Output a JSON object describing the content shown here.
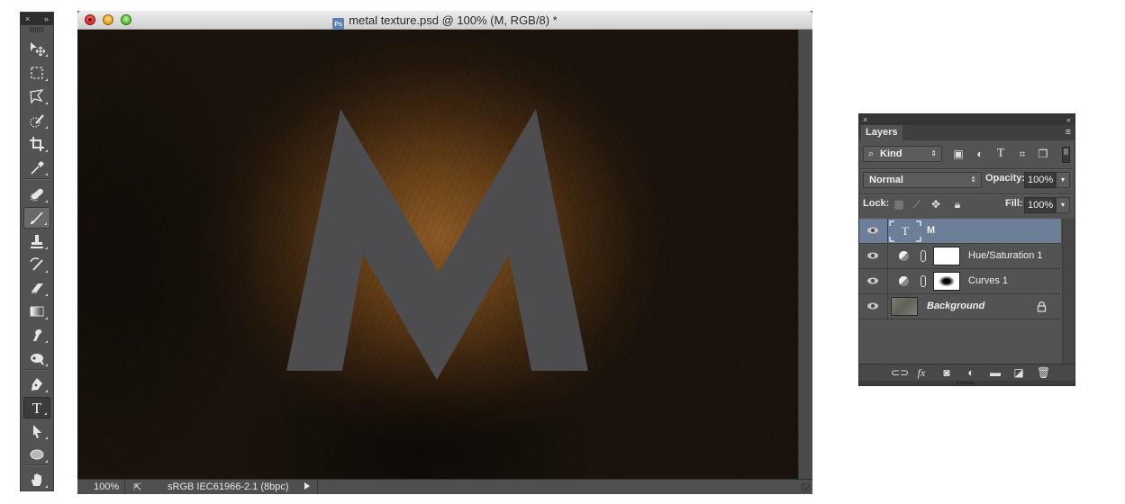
{
  "tools_panel": {
    "header_close": "×",
    "header_expand": "»",
    "tools": [
      {
        "id": "move",
        "label": "Move Tool",
        "icon": "move-icon"
      },
      {
        "id": "marquee",
        "label": "Rectangular Marquee Tool",
        "icon": "marquee-icon"
      },
      {
        "id": "lasso",
        "label": "Polygonal Lasso Tool",
        "icon": "lasso-icon"
      },
      {
        "id": "quick-select",
        "label": "Quick Selection Tool",
        "icon": "quick-select-icon"
      },
      {
        "id": "crop",
        "label": "Crop Tool",
        "icon": "crop-icon"
      },
      {
        "id": "eyedropper",
        "label": "Eyedropper Tool",
        "icon": "eyedropper-icon"
      },
      {
        "id": "healing",
        "label": "Spot Healing Brush Tool",
        "icon": "bandage-icon"
      },
      {
        "id": "brush",
        "label": "Brush Tool",
        "icon": "brush-icon"
      },
      {
        "id": "stamp",
        "label": "Clone Stamp Tool",
        "icon": "stamp-icon"
      },
      {
        "id": "history-brush",
        "label": "History Brush Tool",
        "icon": "history-brush-icon"
      },
      {
        "id": "eraser",
        "label": "Eraser Tool",
        "icon": "eraser-icon"
      },
      {
        "id": "gradient",
        "label": "Gradient Tool",
        "icon": "gradient-icon"
      },
      {
        "id": "smudge",
        "label": "Smudge Tool",
        "icon": "smudge-icon"
      },
      {
        "id": "dodge",
        "label": "Dodge Tool",
        "icon": "dodge-icon"
      },
      {
        "id": "pen",
        "label": "Pen Tool",
        "icon": "pen-icon"
      },
      {
        "id": "type",
        "label": "Horizontal Type Tool",
        "icon": "type-icon",
        "glyph": "T"
      },
      {
        "id": "path-select",
        "label": "Path Selection Tool",
        "icon": "arrow-icon"
      },
      {
        "id": "ellipse",
        "label": "Ellipse Tool",
        "icon": "ellipse-icon"
      },
      {
        "id": "hand",
        "label": "Hand Tool",
        "icon": "hand-icon"
      }
    ],
    "active_tool": "type"
  },
  "document": {
    "title": "metal texture.psd @ 100% (M, RGB/8) *",
    "file_icon_label": "Ps",
    "canvas_text": "M",
    "colors": {
      "letter": "#4d4d50",
      "glow": "#8a5a26",
      "background": "#1a130c"
    },
    "status": {
      "zoom": "100%",
      "profile": "sRGB IEC61966-2.1 (8bpc)"
    }
  },
  "layers_panel": {
    "header_close": "×",
    "header_collapse": "«",
    "tab": "Layers",
    "menu_icon": "≡",
    "filter": {
      "label": "Kind",
      "icons": [
        "image-filter-icon",
        "adjustment-filter-icon",
        "type-filter-icon",
        "shape-filter-icon",
        "smart-object-filter-icon"
      ]
    },
    "blend_mode": "Normal",
    "opacity_label": "Opacity:",
    "opacity_value": "100%",
    "lock_label": "Lock:",
    "fill_label": "Fill:",
    "fill_value": "100%",
    "layers": [
      {
        "name": "M",
        "type": "text",
        "selected": true,
        "visible": true
      },
      {
        "name": "Hue/Saturation 1",
        "type": "adjustment",
        "selected": false,
        "visible": true
      },
      {
        "name": "Curves 1",
        "type": "adjustment",
        "selected": false,
        "visible": true
      },
      {
        "name": "Background",
        "type": "background",
        "selected": false,
        "visible": true,
        "locked": true
      }
    ],
    "footer_icons": [
      "link-layers-icon",
      "fx-icon",
      "add-mask-icon",
      "new-adjustment-icon",
      "new-group-icon",
      "new-layer-icon",
      "trash-icon"
    ],
    "selection_color": "#6d7f98"
  }
}
